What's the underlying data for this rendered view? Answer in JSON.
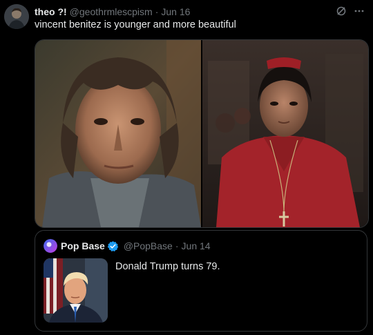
{
  "tweet": {
    "author_name": "theo ?!",
    "author_handle": "@geothrmlescpism",
    "separator": "·",
    "date": "Jun 16",
    "text": "vincent benitez is younger and more beautiful"
  },
  "quoted": {
    "author_name": "Pop Base",
    "author_handle": "@PopBase",
    "separator": "·",
    "date": "Jun 14",
    "text": "Donald Trump turns 79."
  },
  "icons": {
    "header": [
      "grok-icon",
      "more-options-icon"
    ],
    "verified": "verified-badge-icon"
  },
  "colors": {
    "background": "#000000",
    "text_primary": "#e7e9ea",
    "text_secondary": "#71767b",
    "border": "#333639",
    "verified_blue": "#1d9bf0"
  }
}
